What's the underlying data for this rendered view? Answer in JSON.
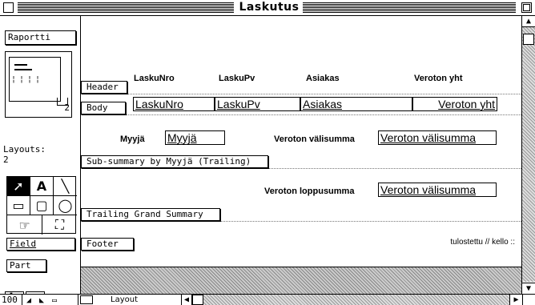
{
  "window": {
    "title": "Laskutus"
  },
  "palette": {
    "report_button": "Raportti",
    "page_number": "2",
    "layouts_label": "Layouts:",
    "layouts_count": "2",
    "field_button": "Field",
    "part_button": "Part",
    "tool_icons": [
      "arrow-tool-icon",
      "text-tool-icon",
      "line-tool-icon",
      "rectangle-tool-icon",
      "rounded-rectangle-tool-icon",
      "oval-tool-icon",
      "button-tool-icon",
      "field-tool-icon"
    ]
  },
  "parts": {
    "header": "Header",
    "body": "Body",
    "subsummary": "Sub-summary by Myyjä (Trailing)",
    "grand_summary": "Trailing Grand Summary",
    "footer": "Footer"
  },
  "header_labels": {
    "laskunro": "LaskuNro",
    "laskupv": "LaskuPv",
    "asiakas": "Asiakas",
    "veroton_yht": "Veroton yht"
  },
  "body_fields": {
    "laskunro": "LaskuNro",
    "laskupv": "LaskuPv",
    "asiakas": "Asiakas",
    "veroton_yht": "Veroton yht"
  },
  "subsummary": {
    "myyja_label": "Myyjä",
    "myyja_field": "Myyjä",
    "valisumma_label": "Veroton välisumma",
    "valisumma_field": "Veroton välisumma"
  },
  "grand_summary": {
    "loppusumma_label": "Veroton loppusumma",
    "loppusumma_field": "Veroton välisumma"
  },
  "footer": {
    "stamp": "tulostettu // kello ::"
  },
  "statusbar": {
    "zoom": "100",
    "mode": "Layout"
  }
}
